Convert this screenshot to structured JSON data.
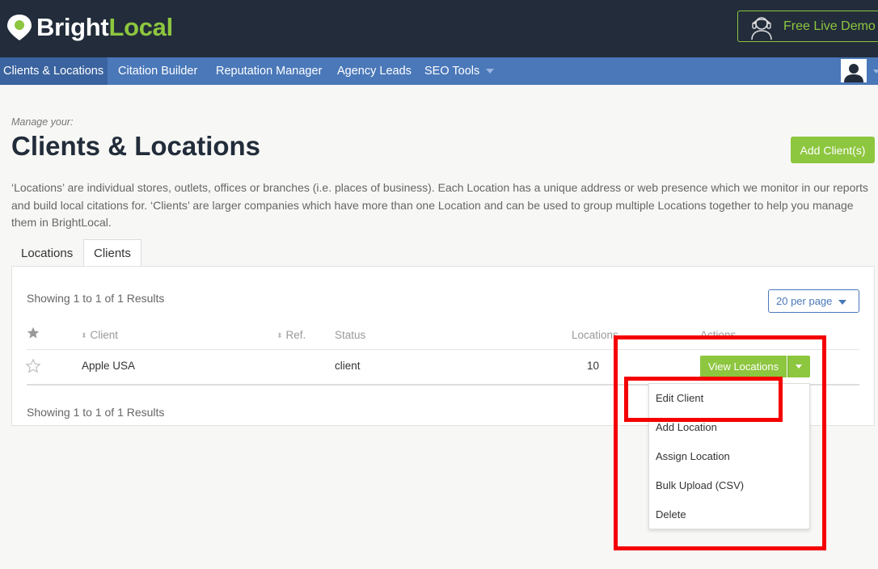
{
  "header": {
    "logo_bright": "Bright",
    "logo_local": "Local",
    "demo_label": "Free Live Demo"
  },
  "nav": {
    "items": [
      {
        "label": "Clients & Locations",
        "active": true
      },
      {
        "label": "Citation Builder"
      },
      {
        "label": "Reputation Manager"
      },
      {
        "label": "Agency Leads"
      },
      {
        "label": "SEO Tools"
      }
    ]
  },
  "page": {
    "manage_label": "Manage your:",
    "title": "Clients & Locations",
    "add_button": "Add Client(s)",
    "description": "‘Locations’ are individual stores, outlets, offices or branches (i.e. places of business). Each Location has a unique address or web presence which we monitor in our reports and build local citations for. ‘Clients’ are larger companies which have more than one Location and can be used to group multiple Locations together to help you manage them in BrightLocal."
  },
  "tabs": [
    {
      "label": "Locations"
    },
    {
      "label": "Clients",
      "active": true
    }
  ],
  "table": {
    "showing_top": "Showing 1 to 1 of 1 Results",
    "showing_bottom": "Showing 1 to 1 of 1 Results",
    "per_page": "20 per page",
    "columns": {
      "client": "Client",
      "ref": "Ref.",
      "status": "Status",
      "locations": "Locations",
      "actions": "Actions"
    },
    "rows": [
      {
        "client": "Apple USA",
        "ref": "",
        "status": "client",
        "locations": "10"
      }
    ],
    "view_button": "View Locations"
  },
  "menu": {
    "items": [
      {
        "label": "Edit Client"
      },
      {
        "label": "Add Location"
      },
      {
        "label": "Assign Location"
      },
      {
        "label": "Bulk Upload (CSV)"
      },
      {
        "label": "Delete"
      }
    ]
  },
  "colors": {
    "header_bg": "#222c3a",
    "nav_bg": "#4a78b9",
    "accent_green": "#8dc63f",
    "highlight_red": "#f40000"
  }
}
